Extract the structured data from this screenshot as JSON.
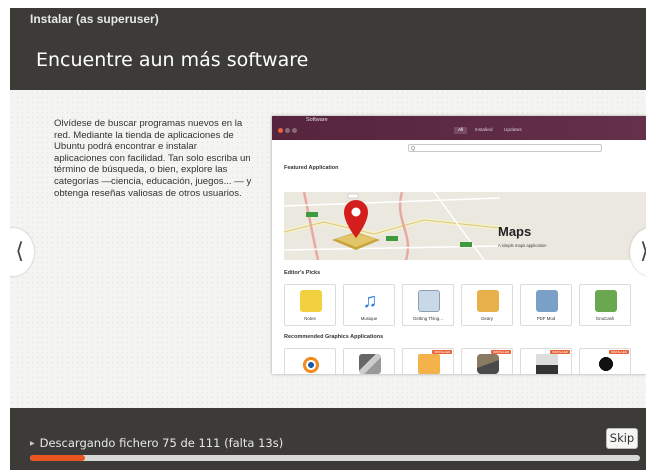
{
  "window": {
    "title": "Instalar (as superuser)"
  },
  "heading": "Encuentre aun más software",
  "slide": {
    "text": "Olvídese de buscar programas nuevos en la red. Mediante la tienda de aplicaciones de Ubuntu podrá encontrar e instalar aplicaciones con facilidad. Tan solo escriba un término de búsqueda, o bien, explore las categorías —ciencia, educación, juegos... — y obtenga reseñas valiosas de otros usuarios.",
    "prev_icon": "chevron-left-icon",
    "next_icon": "chevron-right-icon"
  },
  "software_center": {
    "title": "Software",
    "tabs": [
      "All",
      "Installed",
      "Updates"
    ],
    "active_tab": "All",
    "search_icon": "search-icon",
    "search_glyph": "Q",
    "featured_heading": "Featured Application",
    "featured_app": {
      "name": "Maps",
      "subtitle": "A simple maps application"
    },
    "editors_picks_heading": "Editor's Picks",
    "editors_picks": [
      {
        "label": "Notes",
        "icon": "notes-icon",
        "color": "#f2d040"
      },
      {
        "label": "Musique",
        "icon": "music-note-icon",
        "color": "#2f7ed8"
      },
      {
        "label": "Getting Thing...",
        "icon": "checklist-icon",
        "color": "#c9d8e6"
      },
      {
        "label": "Geary",
        "icon": "mail-icon",
        "color": "#e8b04a"
      },
      {
        "label": "PDF Mod",
        "icon": "pdf-icon",
        "color": "#7aa0c8"
      },
      {
        "label": "GnuCash",
        "icon": "gnucash-icon",
        "color": "#6aa84f"
      }
    ],
    "recommended_heading": "Recommended Graphics Applications",
    "recommended": [
      {
        "icon": "blender-icon",
        "badge": ""
      },
      {
        "icon": "inkscape-icon",
        "badge": ""
      },
      {
        "icon": "image-icon",
        "badge": "INSTALLED"
      },
      {
        "icon": "gimp-icon",
        "badge": "INSTALLED"
      },
      {
        "icon": "scanner-icon",
        "badge": "INSTALLED"
      },
      {
        "icon": "inkscape-pen-icon",
        "badge": "INSTALLED"
      }
    ]
  },
  "status": {
    "text": "Descargando fichero 75 de 111 (falta 13s)",
    "progress_fraction": 0.09
  },
  "skip_button": "Skip",
  "colors": {
    "accent": "#e95420",
    "window_bg": "#3c3b37",
    "titlebar_purple": "#5e2750"
  }
}
